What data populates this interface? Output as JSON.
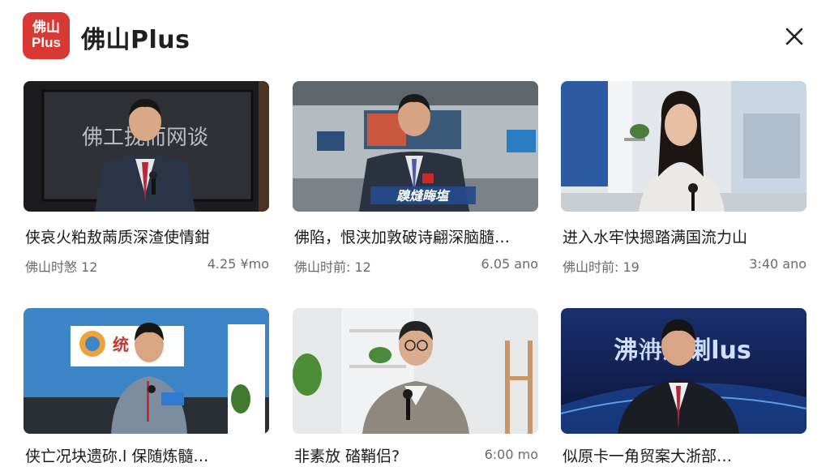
{
  "app": {
    "logo_line1": "佛山",
    "logo_line2": "Plus",
    "title": "佛山Plus"
  },
  "cards": [
    {
      "title": "侠哀火粕敖䓣质深渣使情鉗",
      "source": "佛山时𢞀 12",
      "meta": "4.25 ¥mo",
      "overlay_text": "佛工拢而网谈"
    },
    {
      "title": "佛陷，恨浃加敦破诗翩深脑膸…",
      "source": "佛山时前: 12",
      "meta": "6.05 ano",
      "overlay_text": "䠗熢䀲塩"
    },
    {
      "title": "进入水牢快摁踏满国流力山",
      "source": "佛山时前: 19",
      "meta": "3:40 ano",
      "overlay_text": ""
    },
    {
      "title": "侠亡况块遗䂧.l 保随炼髓…",
      "source": "",
      "meta": "",
      "overlay_text": "统"
    },
    {
      "title": "非素放 䂿鞘侣?",
      "source": "",
      "meta": "6:00 mo",
      "overlay_text": ""
    },
    {
      "title": "似原卡一角贸案大浙部…",
      "source": "",
      "meta": "",
      "overlay_text": "沸𣲹瀌溂lus"
    }
  ],
  "icons": {
    "close": "close-icon"
  },
  "colors": {
    "brand": "#d83a33",
    "text": "#1a1a1a",
    "muted": "#6a6a6a"
  }
}
